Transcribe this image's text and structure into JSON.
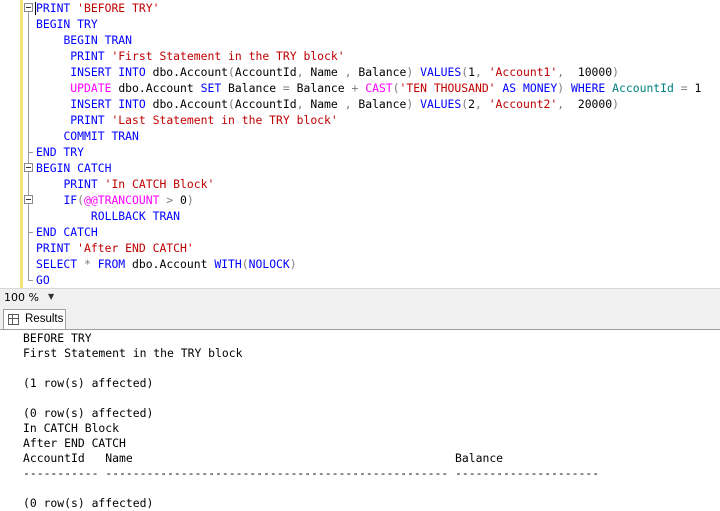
{
  "editor": {
    "lines": [
      [
        {
          "c": "k",
          "t": "PRINT "
        },
        {
          "c": "s",
          "t": "'BEFORE TRY'"
        }
      ],
      [
        {
          "c": "k",
          "t": "BEGIN TRY"
        }
      ],
      [
        {
          "c": "o",
          "t": "    "
        },
        {
          "c": "k",
          "t": "BEGIN TRAN"
        }
      ],
      [
        {
          "c": "o",
          "t": "     "
        },
        {
          "c": "k",
          "t": "PRINT "
        },
        {
          "c": "s",
          "t": "'First Statement in the TRY block'"
        }
      ],
      [
        {
          "c": "o",
          "t": "     "
        },
        {
          "c": "k",
          "t": "INSERT INTO "
        },
        {
          "c": "o",
          "t": "dbo.Account"
        },
        {
          "c": "g",
          "t": "("
        },
        {
          "c": "o",
          "t": "AccountId"
        },
        {
          "c": "g",
          "t": ", "
        },
        {
          "c": "o",
          "t": "Name "
        },
        {
          "c": "g",
          "t": ", "
        },
        {
          "c": "o",
          "t": "Balance"
        },
        {
          "c": "g",
          "t": ") "
        },
        {
          "c": "k",
          "t": "VALUES"
        },
        {
          "c": "g",
          "t": "("
        },
        {
          "c": "o",
          "t": "1"
        },
        {
          "c": "g",
          "t": ", "
        },
        {
          "c": "s",
          "t": "'Account1'"
        },
        {
          "c": "g",
          "t": ",  "
        },
        {
          "c": "o",
          "t": "10000"
        },
        {
          "c": "g",
          "t": ")"
        }
      ],
      [
        {
          "c": "o",
          "t": "     "
        },
        {
          "c": "f",
          "t": "UPDATE "
        },
        {
          "c": "o",
          "t": "dbo.Account "
        },
        {
          "c": "k",
          "t": "SET "
        },
        {
          "c": "o",
          "t": "Balance "
        },
        {
          "c": "g",
          "t": "= "
        },
        {
          "c": "o",
          "t": "Balance "
        },
        {
          "c": "g",
          "t": "+ "
        },
        {
          "c": "f",
          "t": "CAST"
        },
        {
          "c": "g",
          "t": "("
        },
        {
          "c": "s",
          "t": "'TEN THOUSAND'"
        },
        {
          "c": "k",
          "t": " AS "
        },
        {
          "c": "k",
          "t": "MONEY"
        },
        {
          "c": "g",
          "t": ") "
        },
        {
          "c": "k",
          "t": "WHERE "
        },
        {
          "c": "t",
          "t": "AccountId "
        },
        {
          "c": "g",
          "t": "= "
        },
        {
          "c": "o",
          "t": "1"
        }
      ],
      [
        {
          "c": "o",
          "t": "     "
        },
        {
          "c": "k",
          "t": "INSERT INTO "
        },
        {
          "c": "o",
          "t": "dbo.Account"
        },
        {
          "c": "g",
          "t": "("
        },
        {
          "c": "o",
          "t": "AccountId"
        },
        {
          "c": "g",
          "t": ", "
        },
        {
          "c": "o",
          "t": "Name "
        },
        {
          "c": "g",
          "t": ", "
        },
        {
          "c": "o",
          "t": "Balance"
        },
        {
          "c": "g",
          "t": ") "
        },
        {
          "c": "k",
          "t": "VALUES"
        },
        {
          "c": "g",
          "t": "("
        },
        {
          "c": "o",
          "t": "2"
        },
        {
          "c": "g",
          "t": ", "
        },
        {
          "c": "s",
          "t": "'Account2'"
        },
        {
          "c": "g",
          "t": ",  "
        },
        {
          "c": "o",
          "t": "20000"
        },
        {
          "c": "g",
          "t": ")"
        }
      ],
      [
        {
          "c": "o",
          "t": "     "
        },
        {
          "c": "k",
          "t": "PRINT "
        },
        {
          "c": "s",
          "t": "'Last Statement in the TRY block'"
        }
      ],
      [
        {
          "c": "o",
          "t": "    "
        },
        {
          "c": "k",
          "t": "COMMIT TRAN"
        }
      ],
      [
        {
          "c": "k",
          "t": "END TRY"
        }
      ],
      [
        {
          "c": "k",
          "t": "BEGIN CATCH"
        }
      ],
      [
        {
          "c": "o",
          "t": "    "
        },
        {
          "c": "k",
          "t": "PRINT "
        },
        {
          "c": "s",
          "t": "'In CATCH Block'"
        }
      ],
      [
        {
          "c": "o",
          "t": "    "
        },
        {
          "c": "k",
          "t": "IF"
        },
        {
          "c": "g",
          "t": "("
        },
        {
          "c": "f",
          "t": "@@TRANCOUNT"
        },
        {
          "c": "g",
          "t": " > "
        },
        {
          "c": "o",
          "t": "0"
        },
        {
          "c": "g",
          "t": ")"
        }
      ],
      [
        {
          "c": "o",
          "t": "        "
        },
        {
          "c": "k",
          "t": "ROLLBACK TRAN"
        }
      ],
      [
        {
          "c": "k",
          "t": "END CATCH"
        }
      ],
      [
        {
          "c": "k",
          "t": "PRINT "
        },
        {
          "c": "s",
          "t": "'After END CATCH'"
        }
      ],
      [
        {
          "c": "k",
          "t": "SELECT "
        },
        {
          "c": "g",
          "t": "* "
        },
        {
          "c": "k",
          "t": "FROM "
        },
        {
          "c": "o",
          "t": "dbo.Account "
        },
        {
          "c": "k",
          "t": "WITH"
        },
        {
          "c": "g",
          "t": "("
        },
        {
          "c": "k",
          "t": "NOLOCK"
        },
        {
          "c": "g",
          "t": ")"
        }
      ],
      [
        {
          "c": "k",
          "t": "GO"
        }
      ]
    ]
  },
  "zoom": {
    "value": "100 %"
  },
  "results_tab": {
    "label": "Results"
  },
  "results": {
    "lines": [
      "BEFORE TRY",
      "First Statement in the TRY block",
      "",
      "(1 row(s) affected)",
      "",
      "(0 row(s) affected)",
      "In CATCH Block",
      "After END CATCH",
      "AccountId   Name                                               Balance",
      "----------- -------------------------------------------------- ---------------------",
      "",
      "(0 row(s) affected)"
    ]
  },
  "colors": {
    "keyword": "#0000ff",
    "string": "#c00000",
    "function": "#ff00ff",
    "operator": "#7f7f7f",
    "column": "#008080",
    "change_bar": "#f5e27a"
  }
}
